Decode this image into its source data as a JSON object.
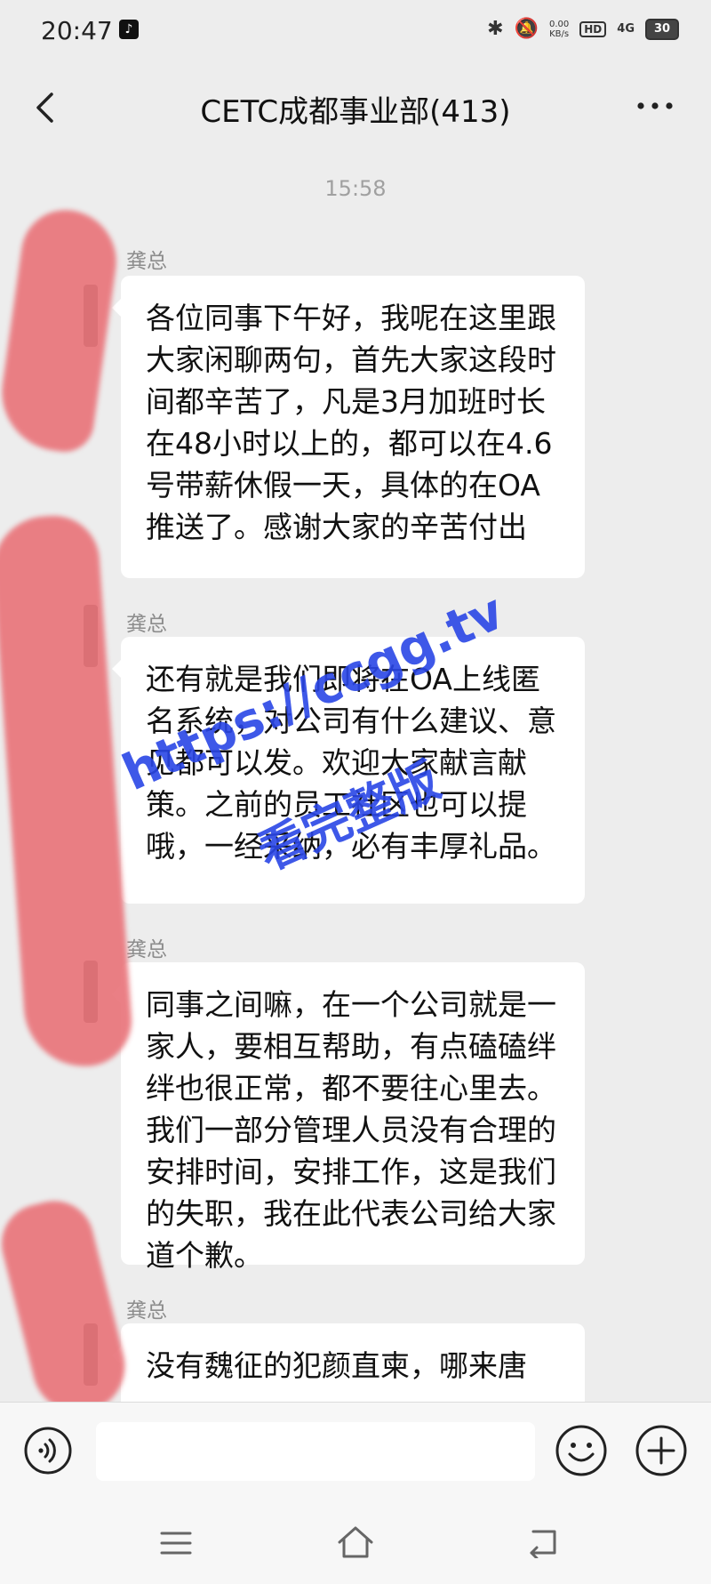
{
  "status_bar": {
    "time": "20:47",
    "net_speed": "0.00\nKB/s",
    "hd": "HD",
    "signal": "4G",
    "battery": "30"
  },
  "header": {
    "title": "CETC成都事业部(413)"
  },
  "timestamp": "15:58",
  "messages": [
    {
      "sender": "龚总",
      "text": "各位同事下午好，我呢在这里跟大家闲聊两句，首先大家这段时间都辛苦了，凡是3月加班时长在48小时以上的，都可以在4.6号带薪休假一天，具体的在OA推送了。感谢大家的辛苦付出"
    },
    {
      "sender": "龚总",
      "text": "还有就是我们即将在OA上线匿名系统，对公司有什么建议、意见都可以发。欢迎大家献言献策。之前的员工社区也可以提哦，一经采纳，必有丰厚礼品。"
    },
    {
      "sender": "龚总",
      "text": "同事之间嘛，在一个公司就是一家人，要相互帮助，有点磕磕绊绊也很正常，都不要往心里去。我们一部分管理人员没有合理的安排时间，安排工作，这是我们的失职，我在此代表公司给大家道个歉。"
    },
    {
      "sender": "龚总",
      "text": "没有魏征的犯颜直柬，哪来唐"
    }
  ],
  "watermark": {
    "line1": "https://ccgg.tv",
    "line2": "看完整版"
  },
  "colors": {
    "background": "#ededed",
    "bubble": "#ffffff",
    "redaction": "#e9757b",
    "watermark": "#2a46e6"
  },
  "icons": {
    "back": "chevron-left-icon",
    "more": "more-dots-icon",
    "voice": "voice-icon",
    "emoji": "emoji-icon",
    "plus": "plus-icon"
  }
}
